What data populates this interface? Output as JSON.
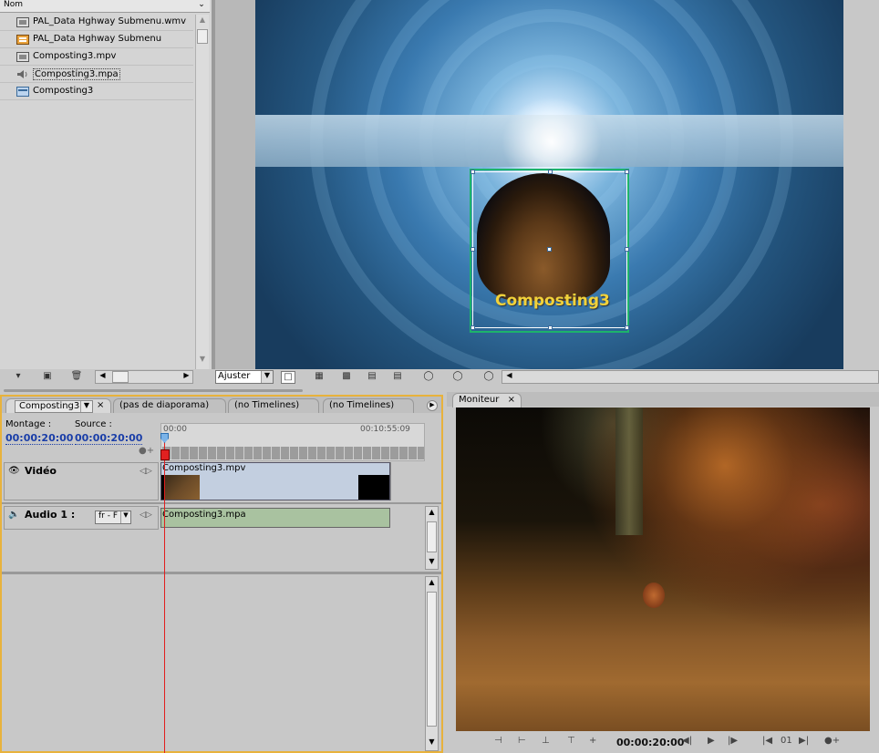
{
  "project": {
    "header_label": "Nom",
    "items": [
      {
        "label": "PAL_Data Hghway Submenu.wmv",
        "icon": "video-file-icon",
        "selected": false
      },
      {
        "label": "PAL_Data Hghway Submenu",
        "icon": "menu-icon",
        "selected": false
      },
      {
        "label": "Composting3.mpv",
        "icon": "video-file-icon",
        "selected": false
      },
      {
        "label": "Composting3.mpa",
        "icon": "audio-file-icon",
        "selected": true
      },
      {
        "label": "Composting3",
        "icon": "timeline-icon",
        "selected": false
      }
    ]
  },
  "preview": {
    "button_title": "Composting3",
    "fit_label": "Ajuster"
  },
  "timeline": {
    "tabs": [
      {
        "label": "Composting3",
        "active": true
      },
      {
        "label": "(pas de diaporama)",
        "active": false
      },
      {
        "label": "(no Timelines)",
        "active": false
      },
      {
        "label": "(no Timelines)",
        "active": false
      }
    ],
    "close_label": "×",
    "montage_label": "Montage :",
    "montage_tc": "00:00:20:00",
    "source_label": "Source :",
    "source_tc": "00:00:20:00",
    "ruler_start": "00:00",
    "ruler_end": "00:10:55:09",
    "video_track_label": "Vidéo",
    "video_clip_label": "Composting3.mpv",
    "audio_track_label": "Audio 1 :",
    "audio_lang": "fr - F",
    "audio_clip_label": "Composting3.mpa"
  },
  "monitor": {
    "tab_label": "Moniteur",
    "close_label": "×",
    "timecode": "00:00:20:00",
    "chapter": "01"
  }
}
